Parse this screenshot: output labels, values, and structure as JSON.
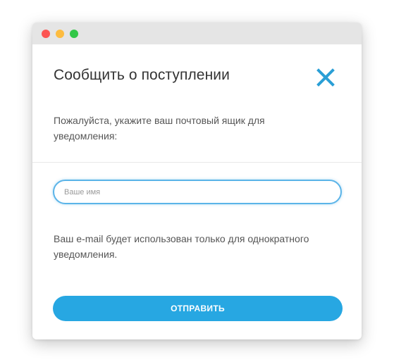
{
  "window": {
    "controls": [
      "close",
      "minimize",
      "maximize"
    ]
  },
  "modal": {
    "title": "Сообщить о поступлении",
    "close_icon": "close-icon",
    "instructions": "Пожалуйста, укажите ваш почтовый ящик для уведомления:",
    "name_input": {
      "value": "",
      "placeholder": "Ваше имя"
    },
    "note": "Ваш e-mail будет использован только для однократного уведомления.",
    "submit_label": "ОТПРАВИТЬ"
  },
  "colors": {
    "accent": "#27a7e2",
    "close_icon": "#2a9fd6",
    "input_border": "#5bb4e8",
    "title_text": "#333333",
    "body_text": "#555555"
  }
}
